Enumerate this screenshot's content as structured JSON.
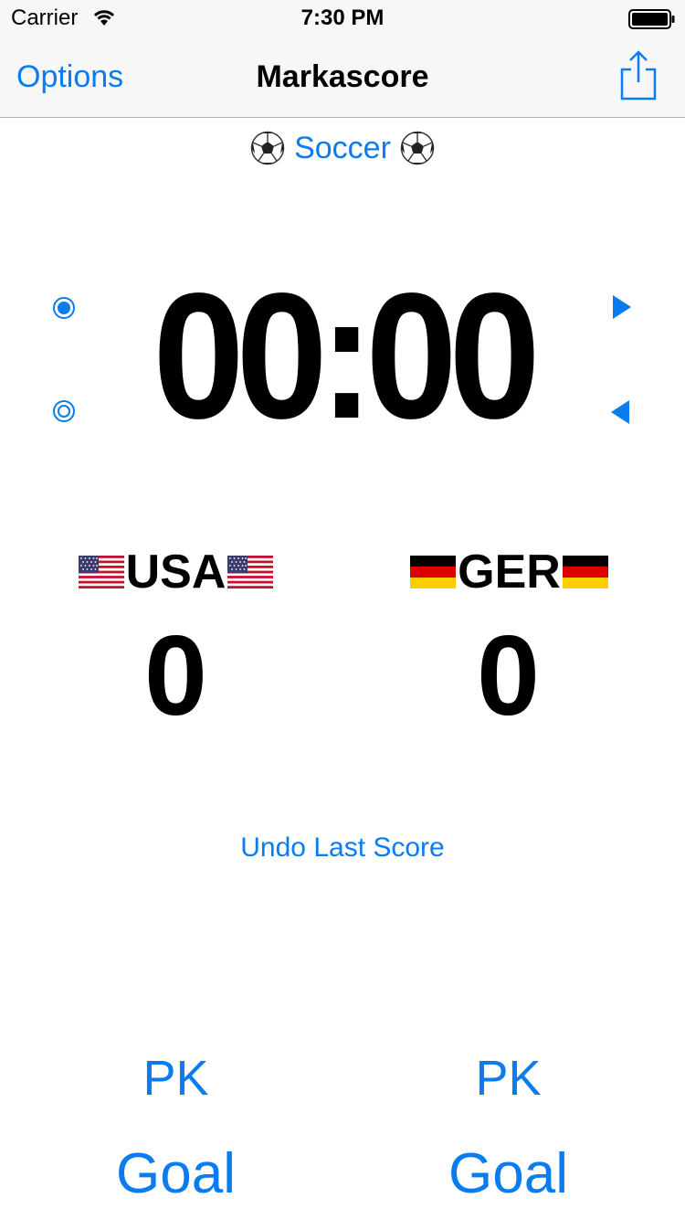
{
  "status_bar": {
    "carrier": "Carrier",
    "time": "7:30 PM"
  },
  "nav": {
    "options_label": "Options",
    "title": "Markascore",
    "share_icon": "share-icon"
  },
  "sport": {
    "label": "Soccer",
    "icon": "soccer-ball-icon"
  },
  "timer": {
    "display": "00:00"
  },
  "teams": [
    {
      "name": "USA",
      "flag": "us-flag-icon",
      "score": "0",
      "pk_label": "PK",
      "goal_label": "Goal"
    },
    {
      "name": "GER",
      "flag": "germany-flag-icon",
      "score": "0",
      "pk_label": "PK",
      "goal_label": "Goal"
    }
  ],
  "undo_label": "Undo Last Score",
  "colors": {
    "accent": "#0a7cf0",
    "bar_background": "#f7f7f7",
    "text": "#000000"
  }
}
